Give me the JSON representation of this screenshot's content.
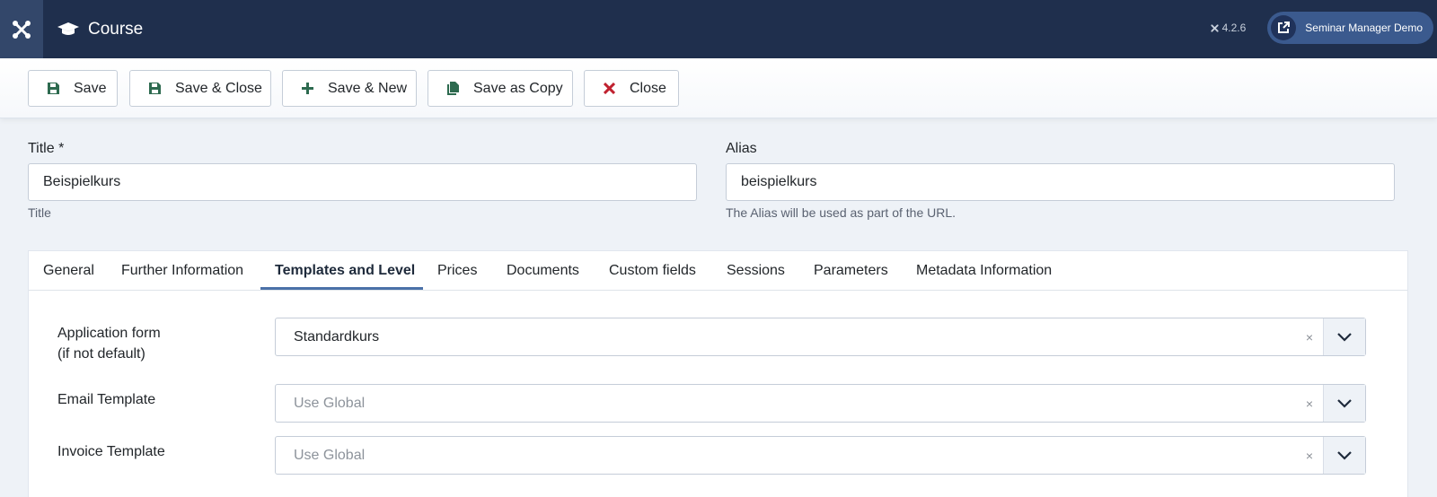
{
  "header": {
    "title": "Course",
    "version": "4.2.6",
    "site_button_label": "Seminar Manager Demo"
  },
  "toolbar": {
    "save": "Save",
    "save_close": "Save & Close",
    "save_new": "Save & New",
    "save_copy": "Save as Copy",
    "close": "Close"
  },
  "form": {
    "title": {
      "label": "Title *",
      "value": "Beispielkurs",
      "help": "Title"
    },
    "alias": {
      "label": "Alias",
      "value": "beispielkurs",
      "help": "The Alias will be used as part of the URL."
    }
  },
  "tabs": [
    {
      "label": "General"
    },
    {
      "label": "Further Information"
    },
    {
      "label": "Templates and Level",
      "active": true
    },
    {
      "label": "Prices"
    },
    {
      "label": "Documents"
    },
    {
      "label": "Custom fields"
    },
    {
      "label": "Sessions"
    },
    {
      "label": "Parameters"
    },
    {
      "label": "Metadata Information"
    }
  ],
  "templates": {
    "application_form": {
      "label_line1": "Application form",
      "label_line2": "(if not default)",
      "value": "Standardkurs"
    },
    "email_template": {
      "label": "Email Template",
      "value": "Use Global"
    },
    "invoice_template": {
      "label": "Invoice Template",
      "value": "Use Global"
    },
    "clear_symbol": "×"
  },
  "colors": {
    "header_bg": "#1f2f4d",
    "save_icon": "#2d6a4f",
    "close_icon": "#c0212f",
    "tab_active_underline": "#4b71a8"
  }
}
